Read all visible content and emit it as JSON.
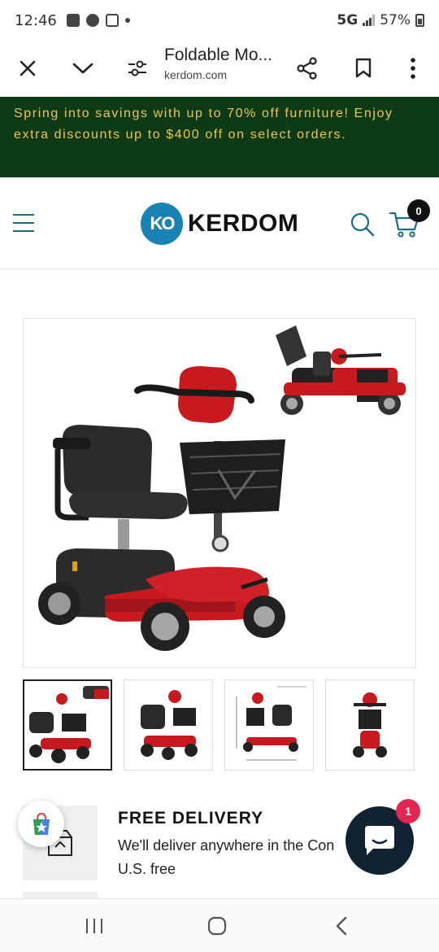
{
  "status_bar": {
    "time": "12:46",
    "network": "5G",
    "battery": "57%",
    "icons": [
      "gallery-icon",
      "chat-icon",
      "wifi-calling-icon",
      "dot-icon"
    ]
  },
  "browser": {
    "page_title": "Foldable Mo...",
    "domain": "kerdom.com",
    "icons": [
      "close-icon",
      "chevron-down-icon",
      "page-settings-icon",
      "share-icon",
      "bookmark-icon",
      "more-vert-icon"
    ]
  },
  "promo": {
    "text": "Spring into savings with up to 70% off furniture! Enjoy extra discounts up to $400 off on select orders."
  },
  "header": {
    "logo_mark": "KO",
    "logo_text": "KERDOM",
    "cart_count": "0",
    "icons": [
      "menu-icon",
      "search-icon",
      "cart-icon"
    ]
  },
  "gallery": {
    "main_image": "mobility-scooter-red",
    "thumbnails": [
      "scooter-front-with-folded-view",
      "scooter-side",
      "scooter-dimensions",
      "scooter-front"
    ],
    "active_thumbnail": 0
  },
  "delivery": {
    "title": "FREE DELIVERY",
    "text": "We'll deliver anywhere in the Con",
    "text_line2": "U.S. free",
    "icon": "box-icon"
  },
  "chat": {
    "unread_count": "1"
  },
  "colors": {
    "promo_bg": "#0e3a16",
    "promo_text": "#f0c64a",
    "brand_blue": "#1a83b5",
    "scooter_red": "#c8191e",
    "chat_bg": "#112233",
    "chat_badge": "#e2264f"
  }
}
